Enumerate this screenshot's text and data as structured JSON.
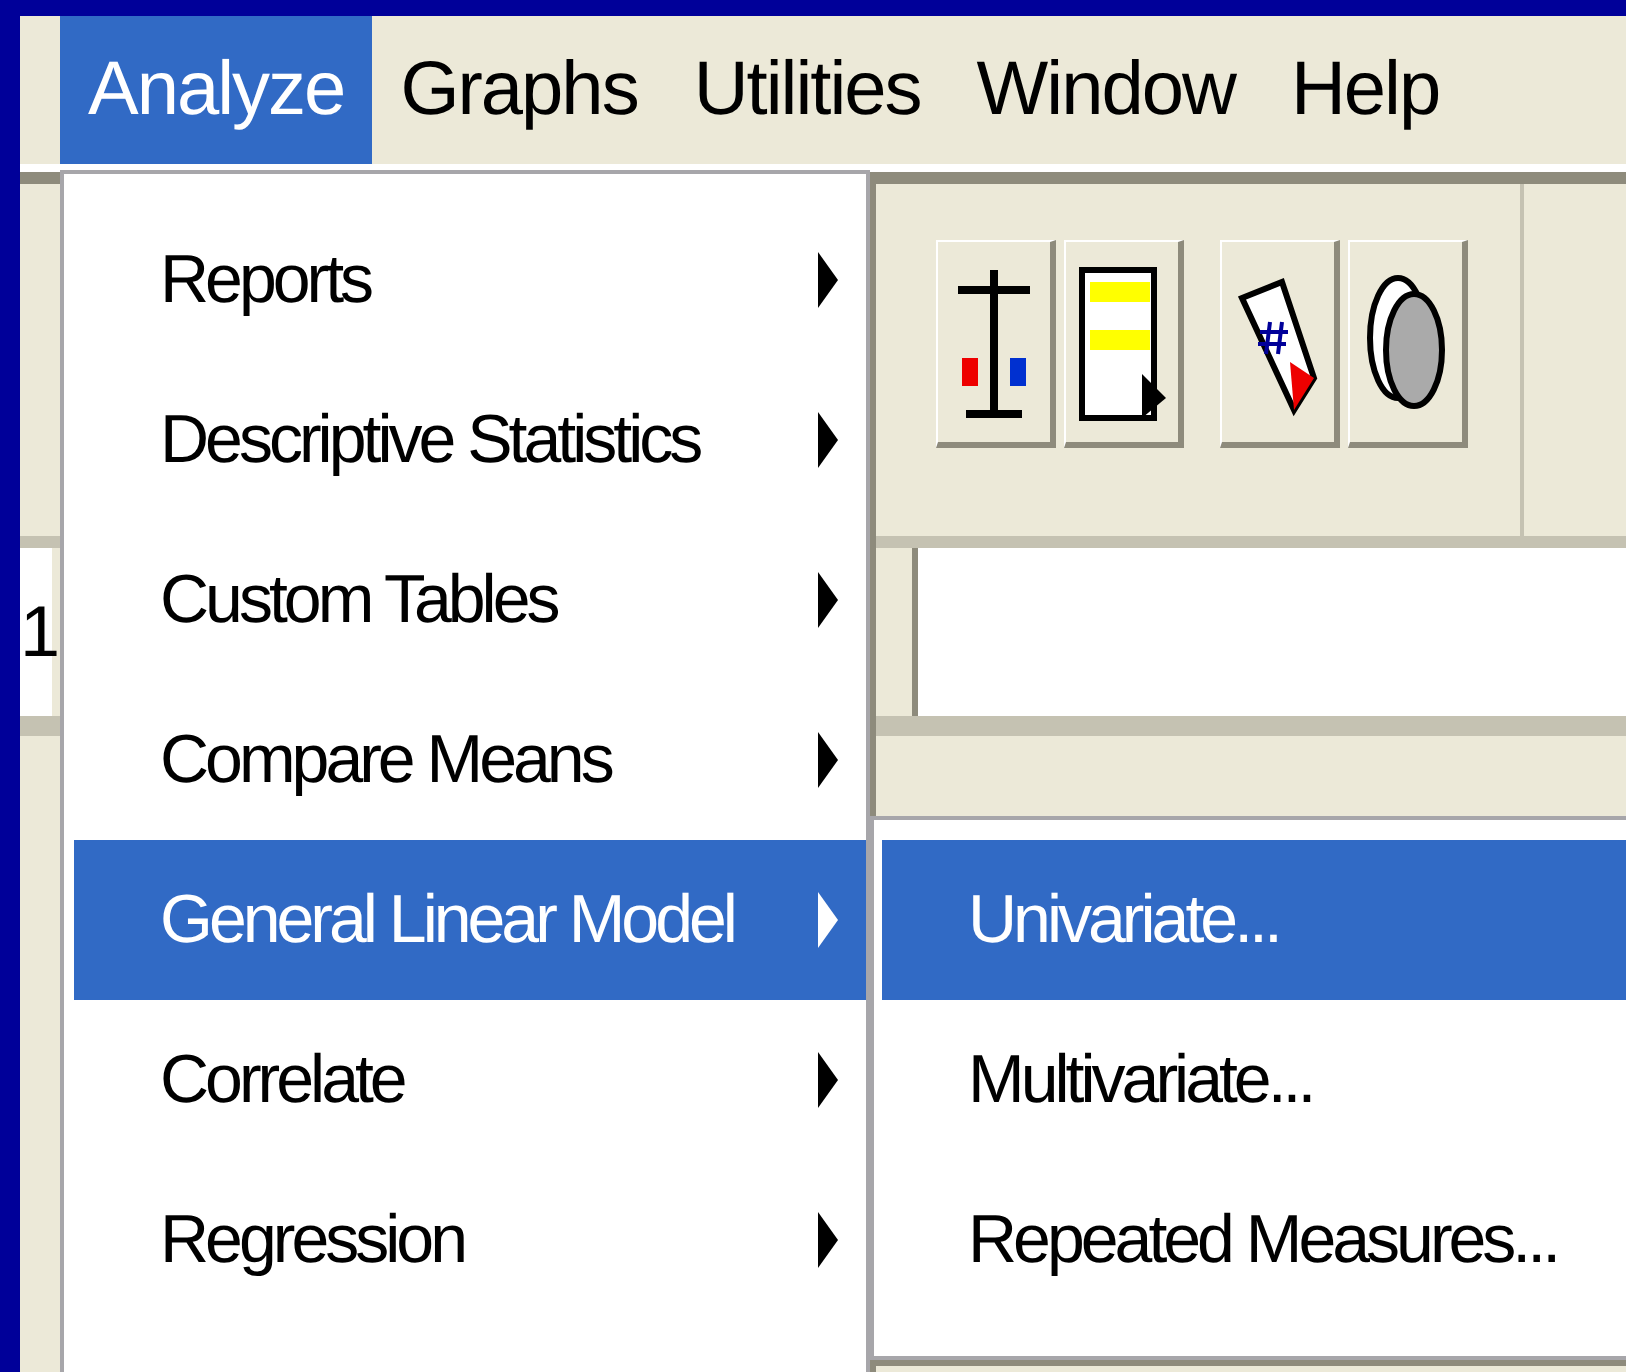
{
  "menu_bar": [
    {
      "label": "Analyze",
      "selected": true
    },
    {
      "label": "Graphs",
      "selected": false
    },
    {
      "label": "Utilities",
      "selected": false
    },
    {
      "label": "Window",
      "selected": false
    },
    {
      "label": "Help",
      "selected": false
    }
  ],
  "analyze_menu": [
    {
      "label": "Reports",
      "selected": false,
      "submenu": true
    },
    {
      "label": "Descriptive Statistics",
      "selected": false,
      "submenu": true
    },
    {
      "label": "Custom Tables",
      "selected": false,
      "submenu": true
    },
    {
      "label": "Compare Means",
      "selected": false,
      "submenu": true
    },
    {
      "label": "General Linear Model",
      "selected": true,
      "submenu": true
    },
    {
      "label": "Correlate",
      "selected": false,
      "submenu": true
    },
    {
      "label": "Regression",
      "selected": false,
      "submenu": true
    }
  ],
  "glm_submenu": [
    {
      "label": "Univariate...",
      "selected": true
    },
    {
      "label": "Multivariate...",
      "selected": false
    },
    {
      "label": "Repeated Measures...",
      "selected": false
    }
  ],
  "cell_value": "1"
}
